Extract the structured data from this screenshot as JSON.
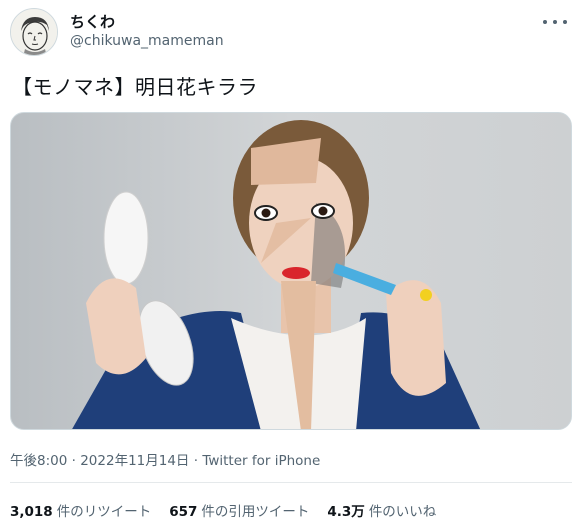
{
  "user": {
    "display_name": "ちくわ",
    "handle": "@chikuwa_mameman",
    "avatar_icon": "hand-drawn-face-avatar"
  },
  "tweet": {
    "text": "【モノマネ】明日花キララ",
    "time": "午後8:00",
    "date": "2022年11月14日",
    "separator": "·",
    "source": "Twitter for iPhone"
  },
  "stats": {
    "retweets_count": "3,018",
    "retweets_label": "件のリツイート",
    "quotes_count": "657",
    "quotes_label": "件の引用ツイート",
    "likes_count": "4.3万",
    "likes_label": "件のいいね"
  },
  "colors": {
    "text": "#0f1419",
    "secondary": "#536471",
    "divider": "#e5e9eb"
  }
}
